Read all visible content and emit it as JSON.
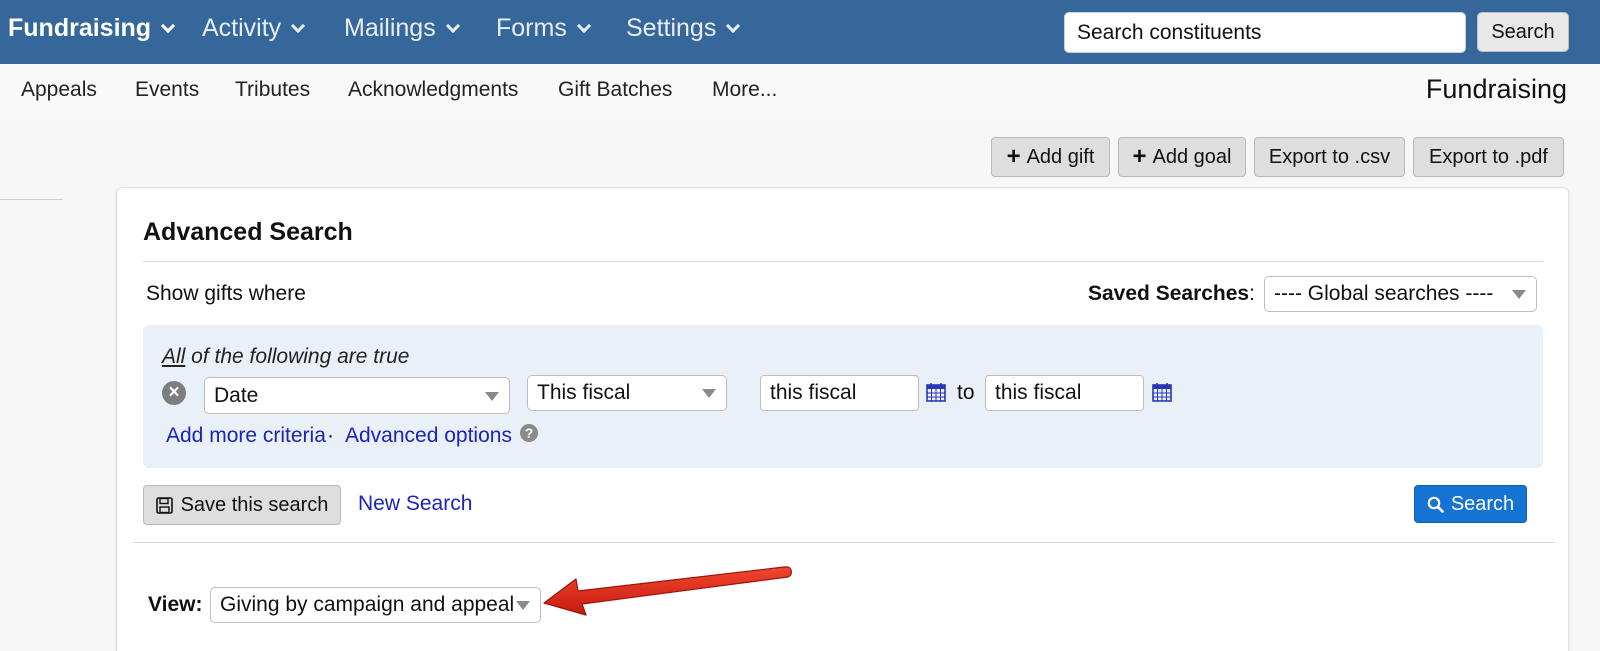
{
  "topnav": {
    "items": [
      {
        "label": "Fundraising",
        "active": true
      },
      {
        "label": "Activity",
        "active": false
      },
      {
        "label": "Mailings",
        "active": false
      },
      {
        "label": "Forms",
        "active": false
      },
      {
        "label": "Settings",
        "active": false
      }
    ],
    "search_placeholder": "Search constituents",
    "search_button": "Search"
  },
  "subnav": {
    "items": [
      "Appeals",
      "Events",
      "Tributes",
      "Acknowledgments",
      "Gift Batches",
      "More..."
    ],
    "title": "Fundraising"
  },
  "actions": {
    "add_gift": "Add gift",
    "add_goal": "Add goal",
    "export_csv": "Export to .csv",
    "export_pdf": "Export to .pdf"
  },
  "advanced_search": {
    "title": "Advanced Search",
    "show_where": "Show gifts where",
    "saved_searches_label": "Saved Searches",
    "saved_searches_value": "---- Global searches ----",
    "all_word": "All",
    "all_rest": " of the following are true",
    "criterion": {
      "field": "Date",
      "period": "This fiscal",
      "from": "this fiscal",
      "to_label": "to",
      "to": "this fiscal"
    },
    "add_more_link": "Add more criteria",
    "separator": "·",
    "advanced_options_link": "Advanced options",
    "save_button": "Save this search",
    "new_search_link": "New Search",
    "search_button": "Search",
    "view_label": "View:",
    "view_value": "Giving by campaign and appeal"
  },
  "colors": {
    "nav_bg": "#35679a",
    "primary": "#1573d4",
    "link": "#1a24b8",
    "criteria_bg": "#eaf0f7",
    "annotation_arrow": "#e0261b"
  }
}
